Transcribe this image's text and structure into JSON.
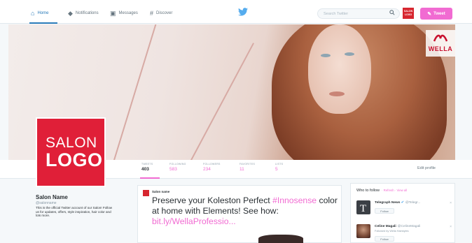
{
  "nav": {
    "items": [
      {
        "label": "Home",
        "icon": "home-icon"
      },
      {
        "label": "Notifications",
        "icon": "bell-icon"
      },
      {
        "label": "Messages",
        "icon": "messages-icon"
      },
      {
        "label": "Discover",
        "icon": "hashtag-icon"
      }
    ],
    "search_placeholder": "Search Twitter",
    "tweet_button": "Tweet",
    "avatar_text": "SALON LOGO"
  },
  "header": {
    "brand": "WELLA",
    "salon_logo_line1": "SALON",
    "salon_logo_line2": "LOGO"
  },
  "stats": [
    {
      "label": "TWEETS",
      "value": "403"
    },
    {
      "label": "FOLLOWING",
      "value": "583"
    },
    {
      "label": "FOLLOWERS",
      "value": "234"
    },
    {
      "label": "FAVORITES",
      "value": "11"
    },
    {
      "label": "LISTS",
      "value": "5"
    }
  ],
  "edit_profile": "Edit profile",
  "profile": {
    "name": "Salon Name",
    "handle": "@salonname",
    "bio": "This is the official Twitter account of our Salon! Follow us for updates, offers, style inspiration, hair color and lots more."
  },
  "tweet": {
    "author": "Salon name",
    "text_part1": "Preserve your Koleston Perfect ",
    "hashtag": "#Innosense",
    "text_part2": " color at home with Elements! See how: ",
    "link": "bit.ly/WellaProfessio..."
  },
  "who_to_follow": {
    "title": "Who to follow",
    "links": "· Refresh · View all",
    "follow_label": "Follow",
    "accounts": [
      {
        "name": "Telegraph News",
        "handle": "@Telegr...",
        "sub": "Promoted"
      },
      {
        "name": "Celine Magali",
        "handle": "@CelineMagali",
        "sub": "Followed by Wella Hairstyles"
      }
    ]
  },
  "colors": {
    "accent": "#f16bd2",
    "twitter_blue": "#2b7bb9",
    "salon_red": "#e01f38"
  }
}
